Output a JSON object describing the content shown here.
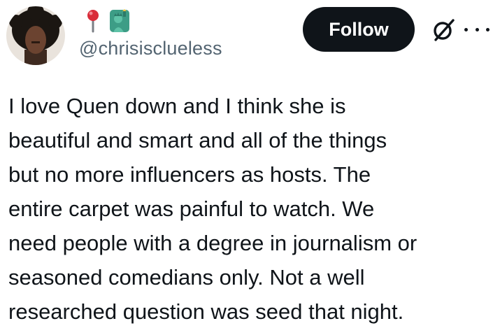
{
  "user": {
    "handle": "@chrisisclueless",
    "name_emojis": [
      "round-pushpin-emoji",
      "statue-of-liberty-emoji"
    ]
  },
  "actions": {
    "follow_label": "Follow",
    "grok_icon": "grok-icon",
    "more_icon": "more-icon"
  },
  "tweet": {
    "lines": [
      "I love Quen down and I think she is",
      "beautiful and smart and all of the things",
      "but no more influencers as hosts. The",
      "entire carpet was painful to watch. We",
      "need people with a degree in journalism or",
      "seasoned comedians only. Not a well",
      "researched question was seed that night."
    ]
  },
  "colors": {
    "text": "#0f1419",
    "secondary": "#536471",
    "button_bg": "#0f1419",
    "button_text": "#ffffff",
    "pin_red": "#d92d3a",
    "liberty_green": "#3d9d86"
  }
}
